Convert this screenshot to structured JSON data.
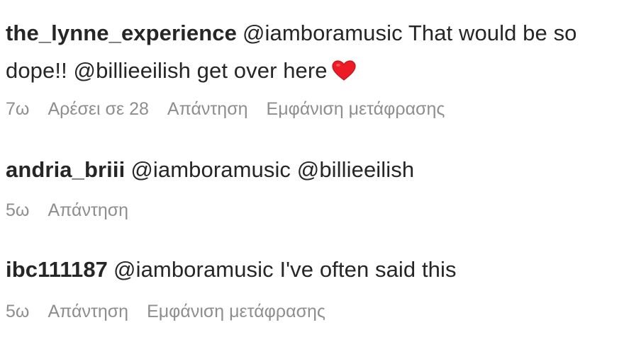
{
  "comments": [
    {
      "username": "the_lynne_experience",
      "mention": "@iamboramusic",
      "text_a": " That would be so dope!! ",
      "mention2": "@billieeilish",
      "text_b": " get over here",
      "emoji_icon": "red-heart-icon",
      "time": "7ω",
      "likes": "Αρέσει σε 28",
      "reply": "Απάντηση",
      "translate": "Εμφάνιση μετάφρασης"
    },
    {
      "username": "andria_briii",
      "mention": "@iamboramusic",
      "mention2": "@billieeilish",
      "time": "5ω",
      "reply": "Απάντηση"
    },
    {
      "username": "ibc111187",
      "mention": "@iamboramusic",
      "text_a": " I've often said this",
      "time": "5ω",
      "reply": "Απάντηση",
      "translate": "Εμφάνιση μετάφρασης"
    }
  ],
  "colors": {
    "text": "#262626",
    "meta": "#8e8e8e",
    "heart": "#ed1c24"
  }
}
